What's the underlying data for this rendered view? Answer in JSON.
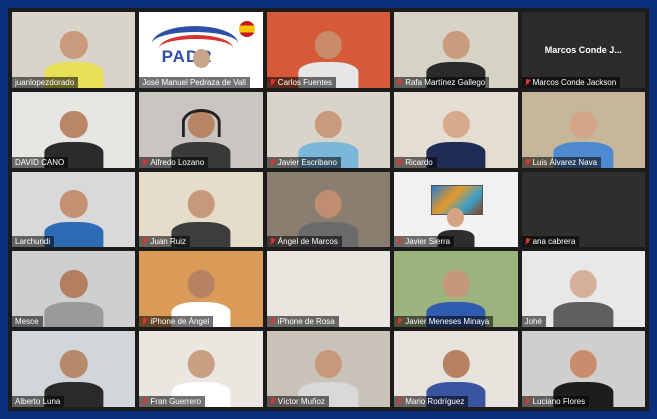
{
  "meeting": {
    "participants": [
      {
        "name": "juanlopezdorado",
        "muted": false,
        "skin": "#c99a7b",
        "shirt": "#e9e05a",
        "bg": "#d8d4cc",
        "type": "person"
      },
      {
        "name": "José Manuel Pedraza de Vall",
        "muted": false,
        "skin": "#c9a58c",
        "shirt": "#ffffff",
        "bg": "#ffffff",
        "type": "logo",
        "logo_text": "PADR",
        "active": true
      },
      {
        "name": "Carlos Fuentes",
        "muted": true,
        "skin": "#c98a6a",
        "shirt": "#e6e6e6",
        "bg": "#d6593a",
        "type": "person"
      },
      {
        "name": "Rafa Martínez Gallego",
        "muted": true,
        "skin": "#c99a7b",
        "shirt": "#2a2a2a",
        "bg": "#d7d2c6",
        "type": "person"
      },
      {
        "name": "Marcos Conde Jackson",
        "muted": true,
        "type": "name-only",
        "label": "Marcos Conde J..."
      },
      {
        "name": "DAVID CANO",
        "muted": false,
        "skin": "#b98668",
        "shirt": "#2b2b2b",
        "bg": "#e8e6e2",
        "type": "person"
      },
      {
        "name": "Alfredo Lozano",
        "muted": true,
        "skin": "#b88466",
        "shirt": "#3a3a3a",
        "bg": "#c9c6c1",
        "type": "headset"
      },
      {
        "name": "Javier Escribano",
        "muted": true,
        "skin": "#c99a7b",
        "shirt": "#7ab7d9",
        "bg": "#d9d4ca",
        "type": "person"
      },
      {
        "name": "Ricardo",
        "muted": true,
        "skin": "#d8a98a",
        "shirt": "#1f2c55",
        "bg": "#e4ddd2",
        "type": "person"
      },
      {
        "name": "Luis Álvarez Nava",
        "muted": true,
        "skin": "#d4a486",
        "shirt": "#4f8ad1",
        "bg": "#c7b79a",
        "type": "person"
      },
      {
        "name": "Larchundi",
        "muted": false,
        "skin": "#c49272",
        "shirt": "#2d6cb5",
        "bg": "#d9d9d9",
        "type": "person"
      },
      {
        "name": "Juan Ruiz",
        "muted": true,
        "skin": "#c8987a",
        "shirt": "#3d3d3d",
        "bg": "#e6dcca",
        "type": "person"
      },
      {
        "name": "Ángel de Marcos",
        "muted": true,
        "skin": "#bf8d70",
        "shirt": "#6a6a6a",
        "bg": "#8a7e71",
        "type": "person"
      },
      {
        "name": "Javier Sierra",
        "muted": true,
        "skin": "#d3a384",
        "shirt": "#2e2e2e",
        "bg": "#f1f1f1",
        "type": "painting"
      },
      {
        "name": "ana cabrera",
        "muted": true,
        "type": "dark",
        "bg": "#2e2e2e"
      },
      {
        "name": "Mesce",
        "muted": false,
        "skin": "#b47e60",
        "shirt": "#9a9a9a",
        "bg": "#cfcfcf",
        "type": "person"
      },
      {
        "name": "iPhone de Ángel",
        "muted": true,
        "skin": "#b98163",
        "shirt": "#ffffff",
        "bg": "#d99b57",
        "type": "person"
      },
      {
        "name": "iPhone de Rosa",
        "muted": true,
        "type": "dark",
        "bg": "#e9e6df"
      },
      {
        "name": "Javier Meneses Minaya",
        "muted": true,
        "skin": "#c7977c",
        "shirt": "#2f5cae",
        "bg": "#9db37e",
        "type": "person"
      },
      {
        "name": "Johé",
        "muted": false,
        "skin": "#d7b09a",
        "shirt": "#5f5f5f",
        "bg": "#e8e8e8",
        "type": "person"
      },
      {
        "name": "Alberto Luna",
        "muted": false,
        "skin": "#b78a6b",
        "shirt": "#2a2a2a",
        "bg": "#d3d6d9",
        "type": "person"
      },
      {
        "name": "Fran Guerrero",
        "muted": true,
        "skin": "#caa083",
        "shirt": "#ffffff",
        "bg": "#eae7e1",
        "type": "person"
      },
      {
        "name": "Víctor Muñoz",
        "muted": true,
        "skin": "#c7987a",
        "shirt": "#d9d9d9",
        "bg": "#c8c2b8",
        "type": "person"
      },
      {
        "name": "Mario Rodríguez",
        "muted": true,
        "skin": "#b78263",
        "shirt": "#3a55a0",
        "bg": "#e6e2dc",
        "type": "person"
      },
      {
        "name": "Luciano Flores",
        "muted": true,
        "skin": "#c98d6e",
        "shirt": "#1d1d1d",
        "bg": "#d0cfcd",
        "type": "person"
      }
    ]
  },
  "colors": {
    "window_bg": "#0b2f7a",
    "grid_bg": "#1c1c1c",
    "active_speaker": "#f2e552",
    "muted_icon": "#e23434"
  }
}
